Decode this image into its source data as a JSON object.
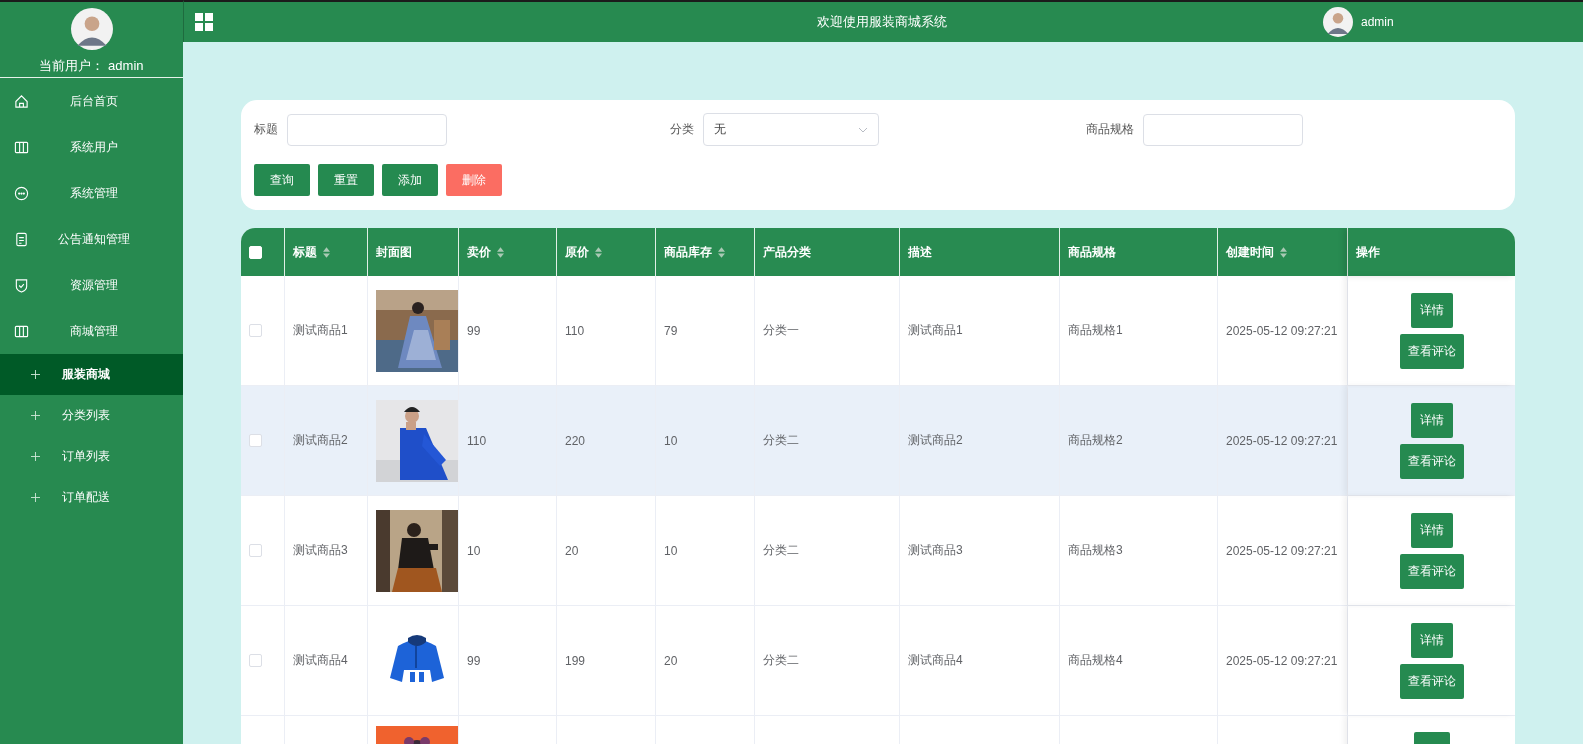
{
  "sidebar": {
    "user_label": "当前用户：",
    "user_name": "admin",
    "items": [
      {
        "label": "后台首页",
        "selected": false
      },
      {
        "label": "系统用户",
        "selected": false
      },
      {
        "label": "系统管理",
        "selected": false
      },
      {
        "label": "公告通知管理",
        "selected": false
      },
      {
        "label": "资源管理",
        "selected": false
      },
      {
        "label": "商城管理",
        "selected": false,
        "children": [
          {
            "label": "服装商城",
            "selected": true
          },
          {
            "label": "分类列表",
            "selected": false
          },
          {
            "label": "订单列表",
            "selected": false
          },
          {
            "label": "订单配送",
            "selected": false
          }
        ]
      }
    ]
  },
  "header": {
    "title": "欢迎使用服装商城系统",
    "user_name": "admin"
  },
  "search": {
    "fields": [
      {
        "label": "标题",
        "kind": "input"
      },
      {
        "label": "分类",
        "kind": "select",
        "value": "无"
      },
      {
        "label": "商品规格",
        "kind": "input"
      }
    ],
    "buttons": [
      {
        "label": "查询",
        "kind": "primary"
      },
      {
        "label": "重置",
        "kind": "primary"
      },
      {
        "label": "添加",
        "kind": "primary"
      },
      {
        "label": "删除",
        "kind": "danger"
      }
    ]
  },
  "table": {
    "all_checked": false,
    "columns": [
      {
        "label": "标题",
        "sortable": true
      },
      {
        "label": "封面图",
        "sortable": false
      },
      {
        "label": "卖价",
        "sortable": true
      },
      {
        "label": "原价",
        "sortable": true
      },
      {
        "label": "商品库存",
        "sortable": true
      },
      {
        "label": "产品分类",
        "sortable": false
      },
      {
        "label": "描述",
        "sortable": false
      },
      {
        "label": "商品规格",
        "sortable": false
      },
      {
        "label": "创建时间",
        "sortable": true
      },
      {
        "label": "操作",
        "sortable": false
      }
    ],
    "rows": [
      {
        "kind": "full",
        "checked": false,
        "hovered": false,
        "cells": [
          "测试商品1",
          "99",
          "110",
          "79",
          "分类一",
          "测试商品1",
          "商品规格1",
          "2025-05-12 09:27:21"
        ],
        "actions": [
          "详情",
          "查看评论"
        ]
      },
      {
        "kind": "full",
        "checked": false,
        "hovered": true,
        "cells": [
          "测试商品2",
          "110",
          "220",
          "10",
          "分类二",
          "测试商品2",
          "商品规格2",
          "2025-05-12 09:27:21"
        ],
        "actions": [
          "详情",
          "查看评论"
        ]
      },
      {
        "kind": "full",
        "checked": false,
        "hovered": false,
        "cells": [
          "测试商品3",
          "10",
          "20",
          "10",
          "分类二",
          "测试商品3",
          "商品规格3",
          "2025-05-12 09:27:21"
        ],
        "actions": [
          "详情",
          "查看评论"
        ]
      },
      {
        "kind": "full",
        "checked": false,
        "hovered": false,
        "cells": [
          "测试商品4",
          "99",
          "199",
          "20",
          "分类二",
          "测试商品4",
          "商品规格4",
          "2025-05-12 09:27:21"
        ],
        "actions": [
          "详情",
          "查看评论"
        ]
      },
      {
        "kind": "partial"
      }
    ]
  }
}
